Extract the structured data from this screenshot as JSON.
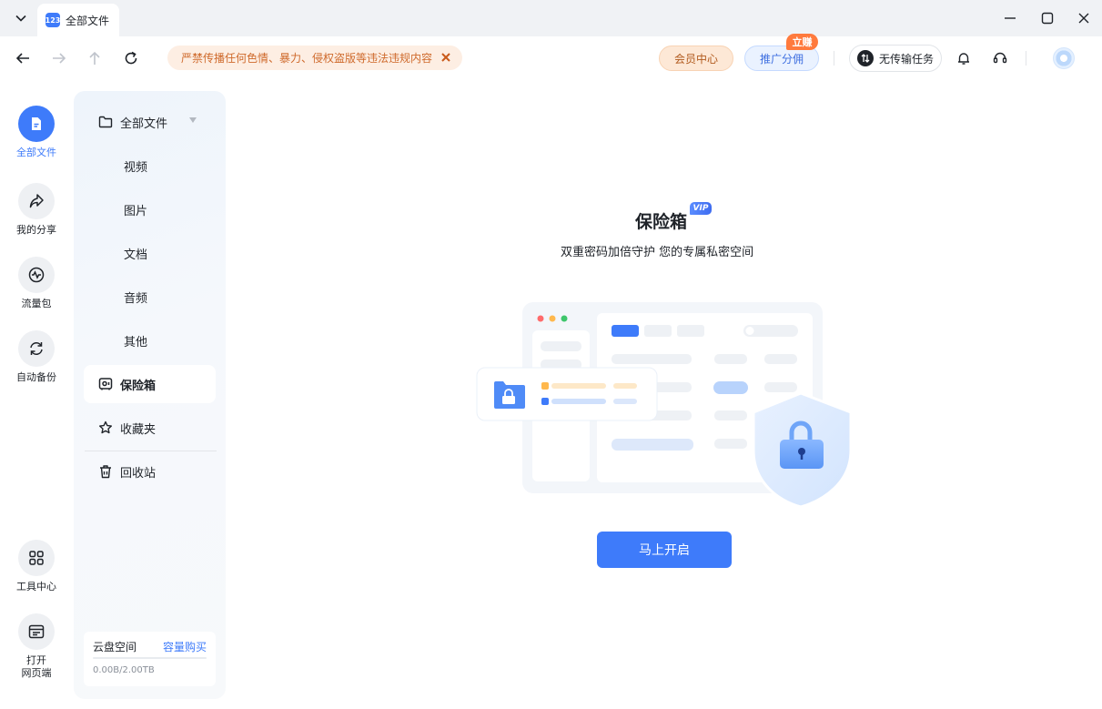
{
  "window": {
    "tab_title": "全部文件",
    "logo_text": "123"
  },
  "toolbar": {
    "warning": "严禁传播任何色情、暴力、侵权盗版等违法违规内容",
    "member_center": "会员中心",
    "promo": "推广分佣",
    "promo_badge": "立赚",
    "transfer": "无传输任务"
  },
  "rail": {
    "items": [
      {
        "label": "全部文件",
        "icon": "file-icon"
      },
      {
        "label": "我的分享",
        "icon": "share-icon"
      },
      {
        "label": "流量包",
        "icon": "traffic-icon"
      },
      {
        "label": "自动备份",
        "icon": "sync-icon"
      },
      {
        "label": "工具中心",
        "icon": "grid-icon"
      },
      {
        "label": "打开\n网页端",
        "icon": "browser-icon"
      }
    ]
  },
  "sidebar": {
    "all_files": "全部文件",
    "sub": [
      "视频",
      "图片",
      "文档",
      "音频",
      "其他"
    ],
    "vault": "保险箱",
    "favorites": "收藏夹",
    "recycle": "回收站",
    "storage_label": "云盘空间",
    "storage_buy": "容量购买",
    "storage_used": "0.00B/2.00TB",
    "storage_fraction": 0.0
  },
  "main": {
    "title": "保险箱",
    "vip": "VIP",
    "subtitle": "双重密码加倍守护 您的专属私密空间",
    "cta": "马上开启"
  },
  "colors": {
    "accent": "#3e7bfa",
    "warning_bg": "#fdeee3",
    "warning_text": "#cf6a2c"
  }
}
